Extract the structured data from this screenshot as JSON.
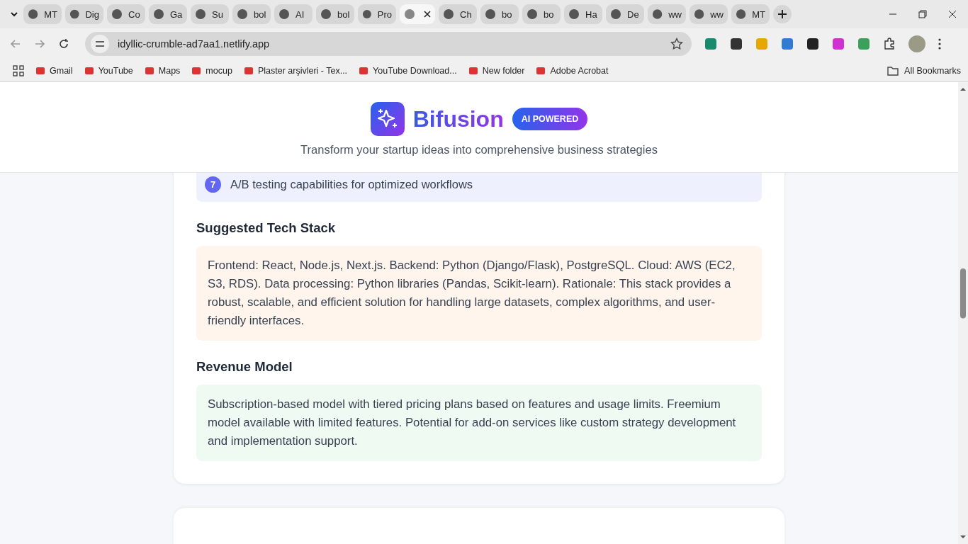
{
  "browser": {
    "tabs": [
      {
        "label": "MT",
        "selected": false
      },
      {
        "label": "Dig",
        "selected": false
      },
      {
        "label": "Co",
        "selected": false
      },
      {
        "label": "Ga",
        "selected": false
      },
      {
        "label": "Su",
        "selected": false
      },
      {
        "label": "bol",
        "selected": false
      },
      {
        "label": "AI",
        "selected": false
      },
      {
        "label": "bol",
        "selected": false
      },
      {
        "label": "Pro",
        "selected": false
      },
      {
        "selected": true
      },
      {
        "label": "Ch",
        "selected": false
      },
      {
        "label": "bo",
        "selected": false
      },
      {
        "label": "bo",
        "selected": false
      },
      {
        "label": "Ha",
        "selected": false
      },
      {
        "label": "De",
        "selected": false
      },
      {
        "label": "ww",
        "selected": false
      },
      {
        "label": "ww",
        "selected": false
      },
      {
        "label": "MT",
        "selected": false
      }
    ],
    "address": "idyllic-crumble-ad7aa1.netlify.app",
    "bookmarks": [
      "Gmail",
      "YouTube",
      "Maps",
      "mocup",
      "Plaster arşivleri - Tex...",
      "YouTube Download...",
      "New folder",
      "Adobe Acrobat"
    ],
    "all_bookmarks": "All Bookmarks"
  },
  "header": {
    "brand": "Bifusion",
    "badge": "AI POWERED",
    "tagline": "Transform your startup ideas into comprehensive business strategies"
  },
  "features": [
    {
      "number": "7",
      "text": "A/B testing capabilities for optimized workflows"
    }
  ],
  "sections": [
    {
      "kind": "tech",
      "title": "Suggested Tech Stack",
      "body": "Frontend: React, Node.js, Next.js. Backend: Python (Django/Flask), PostgreSQL. Cloud: AWS (EC2, S3, RDS). Data processing: Python libraries (Pandas, Scikit-learn). Rationale: This stack provides a robust, scalable, and efficient solution for handling large datasets, complex algorithms, and user-friendly interfaces."
    },
    {
      "kind": "revenue",
      "title": "Revenue Model",
      "body": "Subscription-based model with tiered pricing plans based on features and usage limits. Freemium model available with limited features. Potential for add-on services like custom strategy development and implementation support."
    }
  ]
}
